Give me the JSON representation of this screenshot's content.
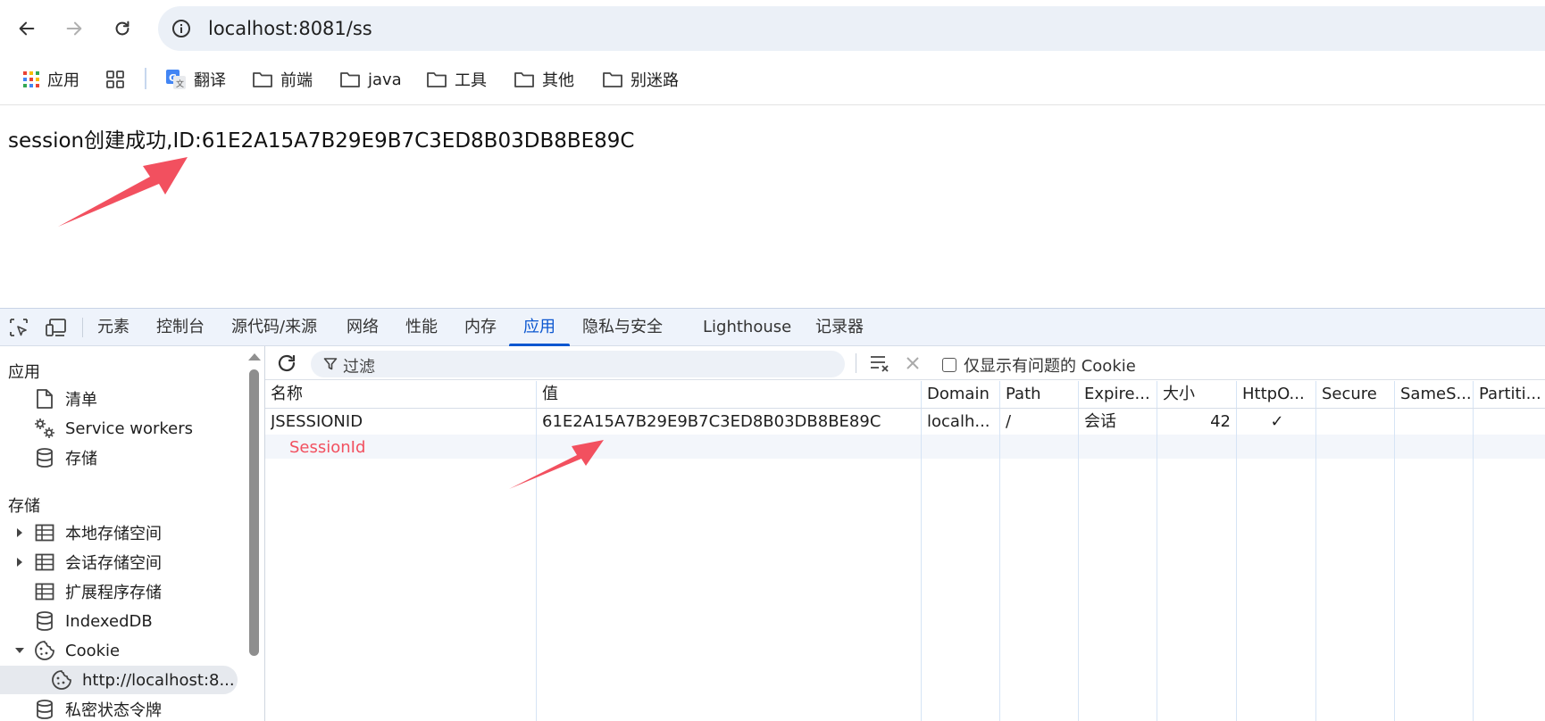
{
  "browser": {
    "url": "localhost:8081/ss",
    "bookmarks": [
      {
        "label": "应用",
        "icon": "apps-grid-icon"
      },
      {
        "label": "",
        "icon": "tab-groups-icon"
      },
      {
        "label": "翻译",
        "icon": "google-translate-icon"
      },
      {
        "label": "前端",
        "icon": "folder-icon"
      },
      {
        "label": "java",
        "icon": "folder-icon"
      },
      {
        "label": "工具",
        "icon": "folder-icon"
      },
      {
        "label": "其他",
        "icon": "folder-icon"
      },
      {
        "label": "别迷路",
        "icon": "folder-icon"
      }
    ]
  },
  "page": {
    "message": "session创建成功,ID:61E2A15A7B29E9B7C3ED8B03DB8BE89C"
  },
  "devtools": {
    "tabs": [
      "元素",
      "控制台",
      "源代码/来源",
      "网络",
      "性能",
      "内存",
      "应用",
      "隐私与安全",
      "Lighthouse",
      "记录器"
    ],
    "active_tab": "应用",
    "sidebar": {
      "app_section": "应用",
      "app_items": [
        {
          "label": "清单",
          "icon": "file-icon"
        },
        {
          "label": "Service workers",
          "icon": "gears-icon"
        },
        {
          "label": "存储",
          "icon": "database-icon"
        }
      ],
      "storage_section": "存储",
      "storage_items": [
        {
          "label": "本地存储空间",
          "icon": "table-icon",
          "expandable": true
        },
        {
          "label": "会话存储空间",
          "icon": "table-icon",
          "expandable": true
        },
        {
          "label": "扩展程序存储",
          "icon": "table-icon",
          "expandable": false
        },
        {
          "label": "IndexedDB",
          "icon": "database-icon",
          "expandable": false
        },
        {
          "label": "Cookie",
          "icon": "cookie-icon",
          "expandable": true,
          "expanded": true
        },
        {
          "label": "http://localhost:8...",
          "icon": "cookie-icon",
          "selected": true
        },
        {
          "label": "私密状态令牌",
          "icon": "database-icon",
          "expandable": false
        }
      ]
    },
    "cookies": {
      "filter_placeholder": "过滤",
      "only_issues_label": "仅显示有问题的 Cookie",
      "columns": [
        "名称",
        "值",
        "Domain",
        "Path",
        "Expire...",
        "大小",
        "HttpO...",
        "Secure",
        "SameS...",
        "Partiti..."
      ],
      "rows": [
        {
          "name": "JSESSIONID",
          "value": "61E2A15A7B29E9B7C3ED8B03DB8BE89C",
          "domain": "localh...",
          "path": "/",
          "expires": "会话",
          "size": "42",
          "httponly": "✓",
          "secure": "",
          "samesite": "",
          "partition": ""
        }
      ]
    }
  },
  "annotations": {
    "session_id_label": "SessionId",
    "arrow_color": "#f2505f"
  }
}
